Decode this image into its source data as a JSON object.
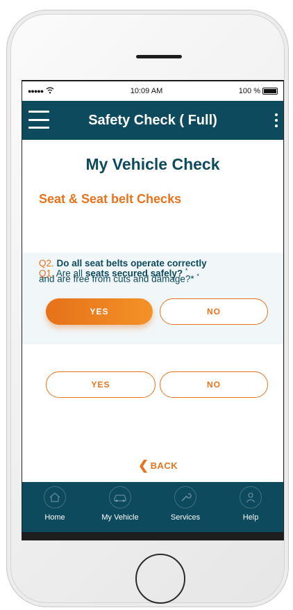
{
  "status_bar": {
    "time": "10:09 AM",
    "battery": "100 %"
  },
  "app_bar": {
    "title": "Safety Check ( Full)"
  },
  "page": {
    "title": "My Vehicle Check",
    "section_title": "Seat & Seat belt Checks"
  },
  "questions": [
    {
      "number": "Q1.",
      "text_before": "Are all ",
      "text_bold": "seats secured safely?",
      "required_mark": "*",
      "yes_label": "YES",
      "no_label": "NO",
      "selected": "YES"
    },
    {
      "number": "Q2.",
      "text_bold": "Do all seat belts operate correctly",
      "text_after": "and are free from cuts and damage?*",
      "required_mark": "*",
      "yes_label": "YES",
      "no_label": "NO",
      "selected": null
    }
  ],
  "back_label": "BACK",
  "tabs": [
    {
      "label": "Home",
      "icon": "home-icon"
    },
    {
      "label": "My Vehicle",
      "icon": "car-icon"
    },
    {
      "label": "Services",
      "icon": "wrench-icon"
    },
    {
      "label": "Help",
      "icon": "help-icon"
    }
  ],
  "colors": {
    "primary": "#0d4a5d",
    "accent": "#e8731c"
  }
}
